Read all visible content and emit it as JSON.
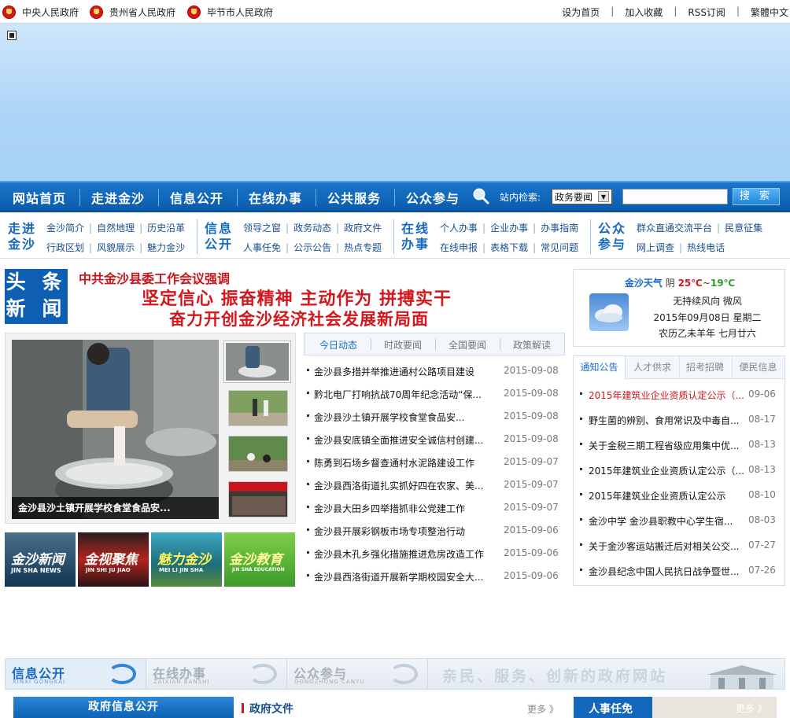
{
  "topbar": {
    "gov_links": [
      "中央人民政府",
      "贵州省人民政府",
      "毕节市人民政府"
    ],
    "links": [
      "设为首页",
      "加入收藏",
      "RSS订阅",
      "繁體中文"
    ],
    "separator": "|"
  },
  "nav": {
    "items": [
      "网站首页",
      "走进金沙",
      "信息公开",
      "在线办事",
      "公共服务",
      "公众参与"
    ],
    "search_label": "站内检索:",
    "search_scope": "政务要闻",
    "search_button": "搜 索"
  },
  "subnav": {
    "groups": [
      {
        "title": "走进金沙",
        "row1": [
          "金沙简介",
          "自然地理",
          "历史沿革"
        ],
        "row2": [
          "行政区划",
          "风貌展示",
          "魅力金沙"
        ]
      },
      {
        "title": "信息公开",
        "row1": [
          "领导之窗",
          "政务动态",
          "政府文件"
        ],
        "row2": [
          "人事任免",
          "公示公告",
          "热点专题"
        ]
      },
      {
        "title": "在线办事",
        "row1": [
          "个人办事",
          "企业办事",
          "办事指南"
        ],
        "row2": [
          "在线申报",
          "表格下载",
          "常见问题"
        ]
      },
      {
        "title": "公众参与",
        "row1": [
          "群众直通交流平台",
          "民意征集"
        ],
        "row2": [
          "网上调查",
          "热线电话"
        ]
      }
    ]
  },
  "headline": {
    "badge": [
      "头 条",
      "新 闻"
    ],
    "subtitle": "中共金沙县委工作会议强调",
    "line1": "坚定信心 振奋精神 主动作为 拼搏实干",
    "line2": "奋力开创金沙经济社会发展新局面"
  },
  "slideshow": {
    "caption": "金沙县沙土镇开展学校食堂食品安..."
  },
  "logos": [
    {
      "title": "金沙新闻",
      "sub": "JIN SHA NEWS",
      "color": "#1d4a70"
    },
    {
      "title": "金视聚焦",
      "sub": "JIN SHI JU JIAO",
      "color": "#b5231c"
    },
    {
      "title": "魅力金沙",
      "sub": "MEI LI JIN SHA",
      "color": "#1d7f8a"
    },
    {
      "title": "金沙教育",
      "sub": "JIN SHA EDUCATION",
      "color": "#4fa735"
    }
  ],
  "news": {
    "tabs": [
      "今日动态",
      "时政要闻",
      "全国要闻",
      "政策解读"
    ],
    "items": [
      {
        "title": "金沙县多措并举推进通村公路项目建设",
        "date": "2015-09-08"
      },
      {
        "title": "黔北电厂打响抗战70周年纪念活动“保...",
        "date": "2015-09-08"
      },
      {
        "title": "金沙县沙土镇开展学校食堂食品安...",
        "date": "2015-09-08"
      },
      {
        "title": "金沙县安底镇全面推进安全诚信村创建...",
        "date": "2015-09-08"
      },
      {
        "title": "陈勇到石场乡督查通村水泥路建设工作",
        "date": "2015-09-07"
      },
      {
        "title": "金沙县西洛街道扎实抓好四在农家、美...",
        "date": "2015-09-07"
      },
      {
        "title": "金沙县大田乡四举措抓非公党建工作",
        "date": "2015-09-07"
      },
      {
        "title": "金沙县开展彩钢板市场专项整治行动",
        "date": "2015-09-06"
      },
      {
        "title": "金沙县木孔乡强化措施推进危房改造工作",
        "date": "2015-09-06"
      },
      {
        "title": "金沙县西洛街道开展新学期校园安全大...",
        "date": "2015-09-06"
      }
    ]
  },
  "weather": {
    "place": "金沙天气",
    "cond": "阴",
    "high": "25℃",
    "tilde": "~",
    "low": "19℃",
    "wind": "无持续风向 微风",
    "date": "2015年09月08日 星期二",
    "lunar": "农历乙未羊年 七月廿六"
  },
  "notice": {
    "tabs": [
      "通知公告",
      "人才供求",
      "招考招聘",
      "便民信息"
    ],
    "items": [
      {
        "title": "2015年建筑业企业资质认定公示（...",
        "date": "09-06",
        "highlight": true
      },
      {
        "title": "野生菌的辨别、食用常识及中毒自...",
        "date": "08-17"
      },
      {
        "title": "关于金税三期工程省级应用集中优...",
        "date": "08-13"
      },
      {
        "title": "2015年建筑业企业资质认定公示（...",
        "date": "08-13"
      },
      {
        "title": "2015年建筑业企业资质认定公示",
        "date": "08-10"
      },
      {
        "title": "金沙中学 金沙县职教中心学生宿...",
        "date": "08-03"
      },
      {
        "title": "关于金沙客运站搬迁后对相关公交...",
        "date": "07-27"
      },
      {
        "title": "金沙县纪念中国人民抗日战争暨世...",
        "date": "07-26"
      }
    ]
  },
  "strip": {
    "cells": [
      {
        "title": "信息公开",
        "en": "XINXI GONGKAI",
        "active": true
      },
      {
        "title": "在线办事",
        "en": "ZAIXIAN BANSHI"
      },
      {
        "title": "公众参与",
        "en": "GONGZHONG CANYU"
      }
    ],
    "slogan": "亲民、服务、创新的政府网站"
  },
  "bottom": {
    "zf_button": "政府信息公开",
    "zf_title": "政府文件",
    "more": "更多 》",
    "rs_title": "人事任免",
    "rs_more": "更多 》"
  }
}
